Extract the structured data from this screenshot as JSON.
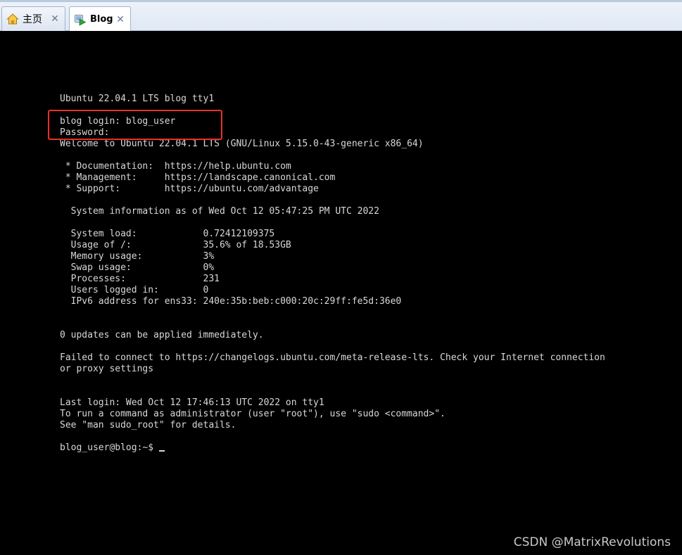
{
  "tabs": [
    {
      "label": "主页",
      "icon": "home-icon",
      "active": false
    },
    {
      "label": "Blog",
      "icon": "vm-play-icon",
      "active": true
    }
  ],
  "close_glyph": "✕",
  "terminal": {
    "lines": [
      "Ubuntu 22.04.1 LTS blog tty1",
      "",
      "blog login: blog_user",
      "Password:",
      "Welcome to Ubuntu 22.04.1 LTS (GNU/Linux 5.15.0-43-generic x86_64)",
      "",
      " * Documentation:  https://help.ubuntu.com",
      " * Management:     https://landscape.canonical.com",
      " * Support:        https://ubuntu.com/advantage",
      "",
      "  System information as of Wed Oct 12 05:47:25 PM UTC 2022",
      "",
      "  System load:            0.72412109375",
      "  Usage of /:             35.6% of 18.53GB",
      "  Memory usage:           3%",
      "  Swap usage:             0%",
      "  Processes:              231",
      "  Users logged in:        0",
      "  IPv6 address for ens33: 240e:35b:beb:c000:20c:29ff:fe5d:36e0",
      "",
      "",
      "0 updates can be applied immediately.",
      "",
      "Failed to connect to https://changelogs.ubuntu.com/meta-release-lts. Check your Internet connection",
      "or proxy settings",
      "",
      "",
      "Last login: Wed Oct 12 17:46:13 UTC 2022 on tty1",
      "To run a command as administrator (user \"root\"), use \"sudo <command>\".",
      "See \"man sudo_root\" for details.",
      ""
    ],
    "prompt": "blog_user@blog:~$ "
  },
  "annotation": {
    "color": "#e8302a"
  },
  "watermark": "CSDN @MatrixRevolutions"
}
